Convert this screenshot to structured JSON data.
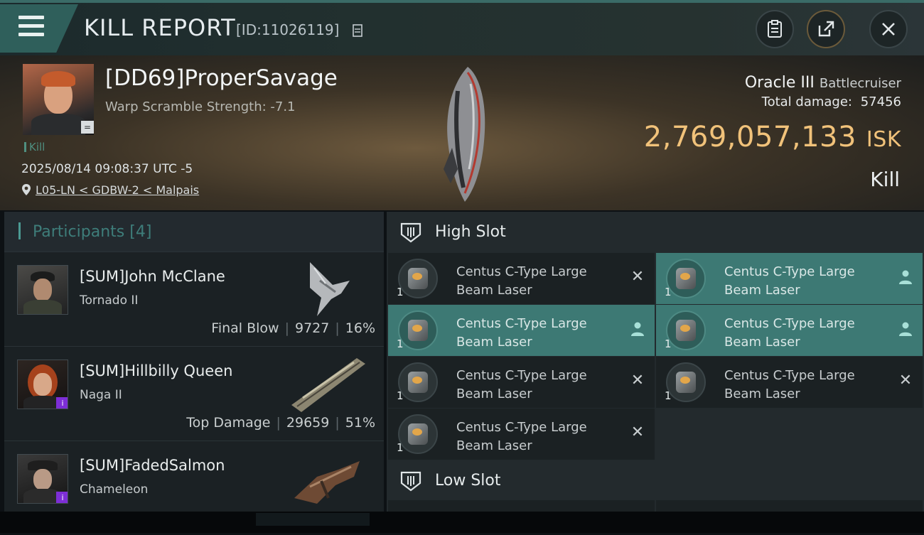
{
  "header": {
    "title": "KILL REPORT",
    "id_text": "[ID:11026119]"
  },
  "victim": {
    "name": "[DD69]ProperSavage",
    "subtitle": "Warp Scramble Strength: -7.1",
    "kill_tag": "Kill",
    "datetime": "2025/08/14 09:08:37 UTC -5",
    "location": "L05-LN < GDBW-2 < Malpais",
    "ship_name": "Oracle III",
    "ship_class": "Battlecruiser",
    "total_damage_label": "Total damage:",
    "total_damage": "57456",
    "isk_value": "2,769,057,133",
    "isk_unit": "ISK",
    "kill_type": "Kill"
  },
  "participants": {
    "title": "Participants",
    "count": "[4]",
    "rows": [
      {
        "name": "[SUM]John McClane",
        "ship": "Tornado II",
        "role": "Final Blow",
        "damage": "9727",
        "percent": "16%"
      },
      {
        "name": "[SUM]Hillbilly Queen",
        "ship": "Naga II",
        "role": "Top Damage",
        "damage": "29659",
        "percent": "51%"
      },
      {
        "name": "[SUM]FadedSalmon",
        "ship": "Chameleon"
      }
    ]
  },
  "fitting": {
    "high_slot_title": "High Slot",
    "low_slot_title": "Low Slot",
    "modules": [
      {
        "name": "Centus C-Type Large Beam Laser",
        "qty": "1",
        "state": "destroyed"
      },
      {
        "name": "Centus C-Type Large Beam Laser",
        "qty": "1",
        "state": "dropped"
      },
      {
        "name": "Centus C-Type Large Beam Laser",
        "qty": "1",
        "state": "dropped"
      },
      {
        "name": "Centus C-Type Large Beam Laser",
        "qty": "1",
        "state": "dropped"
      },
      {
        "name": "Centus C-Type Large Beam Laser",
        "qty": "1",
        "state": "destroyed"
      },
      {
        "name": "Centus C-Type Large Beam Laser",
        "qty": "1",
        "state": "destroyed"
      },
      {
        "name": "Centus C-Type Large Beam Laser",
        "qty": "1",
        "state": "destroyed"
      }
    ]
  },
  "colors": {
    "accent_teal": "#3d7974",
    "isk_gold": "#f1c27a"
  }
}
